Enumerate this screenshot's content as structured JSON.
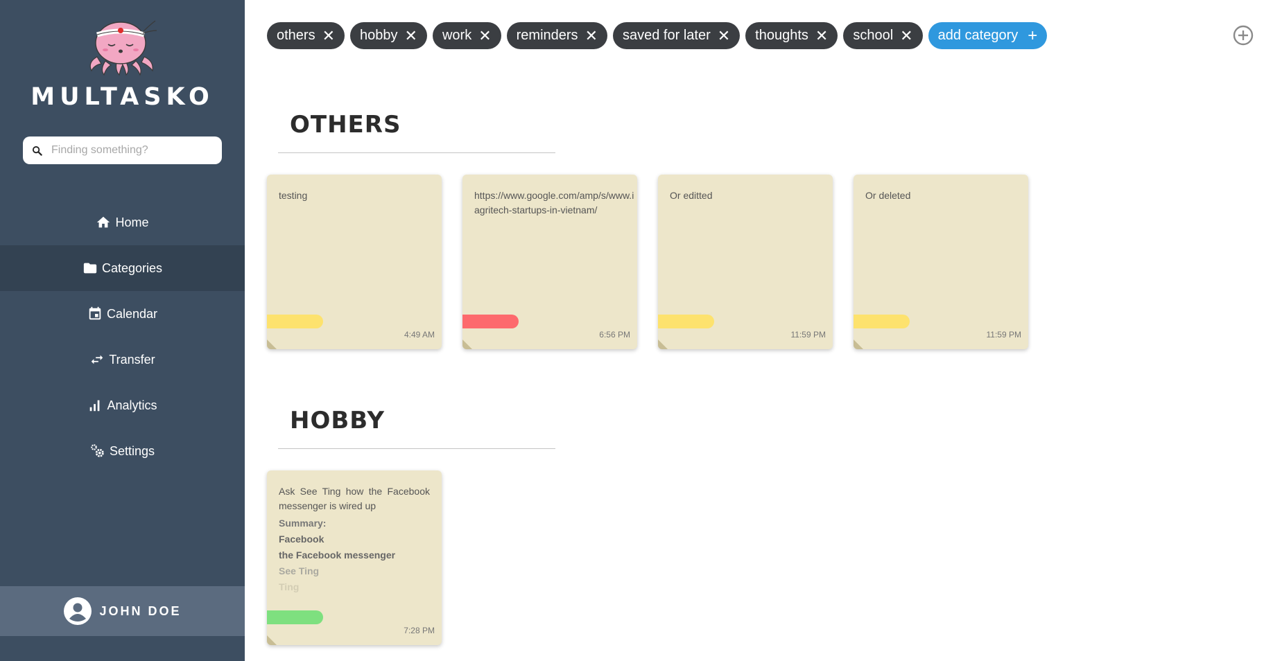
{
  "app": {
    "brand": "MULTASKO"
  },
  "search": {
    "placeholder": "Finding something?"
  },
  "nav": {
    "items": [
      {
        "label": "Home",
        "icon": "home-icon"
      },
      {
        "label": "Categories",
        "icon": "folder-icon",
        "active": true
      },
      {
        "label": "Calendar",
        "icon": "calendar-icon"
      },
      {
        "label": "Transfer",
        "icon": "transfer-icon"
      },
      {
        "label": "Analytics",
        "icon": "analytics-icon"
      },
      {
        "label": "Settings",
        "icon": "settings-icon"
      }
    ]
  },
  "user": {
    "name": "JOHN DOE",
    "icon": "user-circle-icon"
  },
  "chips": [
    {
      "label": "others"
    },
    {
      "label": "hobby"
    },
    {
      "label": "work"
    },
    {
      "label": "reminders"
    },
    {
      "label": "saved for later"
    },
    {
      "label": "thoughts"
    },
    {
      "label": "school"
    }
  ],
  "add_category": {
    "label": "add category",
    "icon": "plus-icon"
  },
  "corner_add": {
    "icon": "plus-circle-icon"
  },
  "colors": {
    "sidebar": "#3d4e61",
    "sidebar_active": "#334252",
    "user_bar": "#5b6b7f",
    "chip": "#3b3e42",
    "accent": "#2f98de",
    "note": "#ede6ca",
    "tag_yellow": "#fde26e",
    "tag_red": "#fd6a6d",
    "tag_green": "#7ee07f"
  },
  "sections": [
    {
      "title": "OTHERS",
      "notes": [
        {
          "text": "testing",
          "time": "4:49 AM",
          "tag_color": "#fde26e"
        },
        {
          "text": "https://www.google.com/amp/s/www.i agritech-startups-in-vietnam/",
          "time": "6:56 PM",
          "tag_color": "#fd6a6d"
        },
        {
          "text": "Or editted",
          "time": "11:59 PM",
          "tag_color": "#fde26e"
        },
        {
          "text": "Or deleted",
          "time": "11:59 PM",
          "tag_color": "#fde26e"
        }
      ]
    },
    {
      "title": "HOBBY",
      "notes": [
        {
          "text": "Ask See Ting how the Facebook messenger is wired up",
          "summary_label": "Summary:",
          "summary_lines": [
            "Facebook",
            "the Facebook messenger",
            "See Ting",
            "Ting"
          ],
          "time": "7:28 PM",
          "tag_color": "#7ee07f"
        }
      ]
    }
  ]
}
